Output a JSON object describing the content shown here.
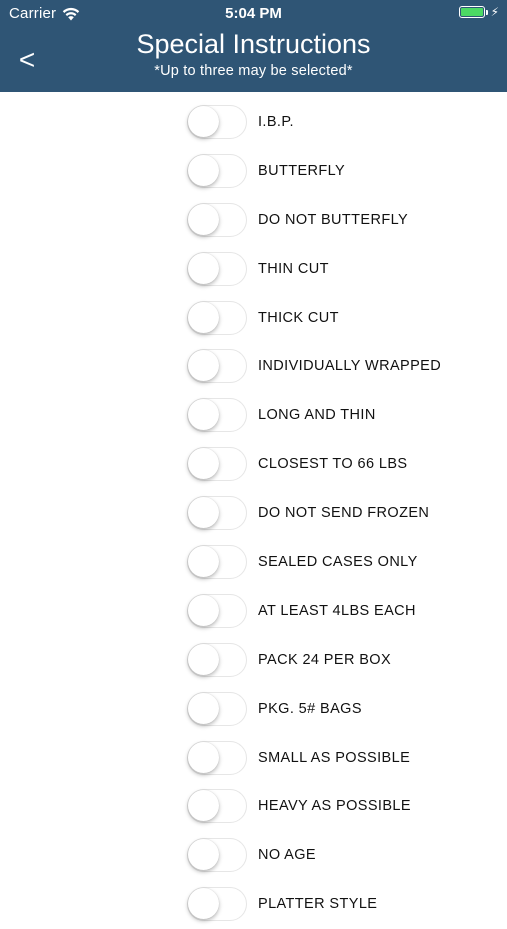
{
  "status_bar": {
    "carrier": "Carrier",
    "time": "5:04 PM",
    "battery_color": "#4cd964"
  },
  "header": {
    "back_label": "<",
    "title": "Special Instructions",
    "subtitle": "*Up to three may be selected*",
    "background_color": "#2f5575"
  },
  "options": [
    {
      "label": "I.B.P.",
      "on": false
    },
    {
      "label": "BUTTERFLY",
      "on": false
    },
    {
      "label": "DO NOT BUTTERFLY",
      "on": false
    },
    {
      "label": "THIN CUT",
      "on": false
    },
    {
      "label": "THICK CUT",
      "on": false
    },
    {
      "label": "INDIVIDUALLY WRAPPED",
      "on": false
    },
    {
      "label": "LONG AND THIN",
      "on": false
    },
    {
      "label": "CLOSEST TO 66 LBS",
      "on": false
    },
    {
      "label": "DO NOT SEND FROZEN",
      "on": false
    },
    {
      "label": "SEALED CASES ONLY",
      "on": false
    },
    {
      "label": "AT LEAST 4LBS EACH",
      "on": false
    },
    {
      "label": "PACK 24 PER BOX",
      "on": false
    },
    {
      "label": "PKG. 5# BAGS",
      "on": false
    },
    {
      "label": "SMALL AS POSSIBLE",
      "on": false
    },
    {
      "label": "HEAVY AS POSSIBLE",
      "on": false
    },
    {
      "label": "NO AGE",
      "on": false
    },
    {
      "label": "PLATTER STYLE",
      "on": false
    }
  ]
}
